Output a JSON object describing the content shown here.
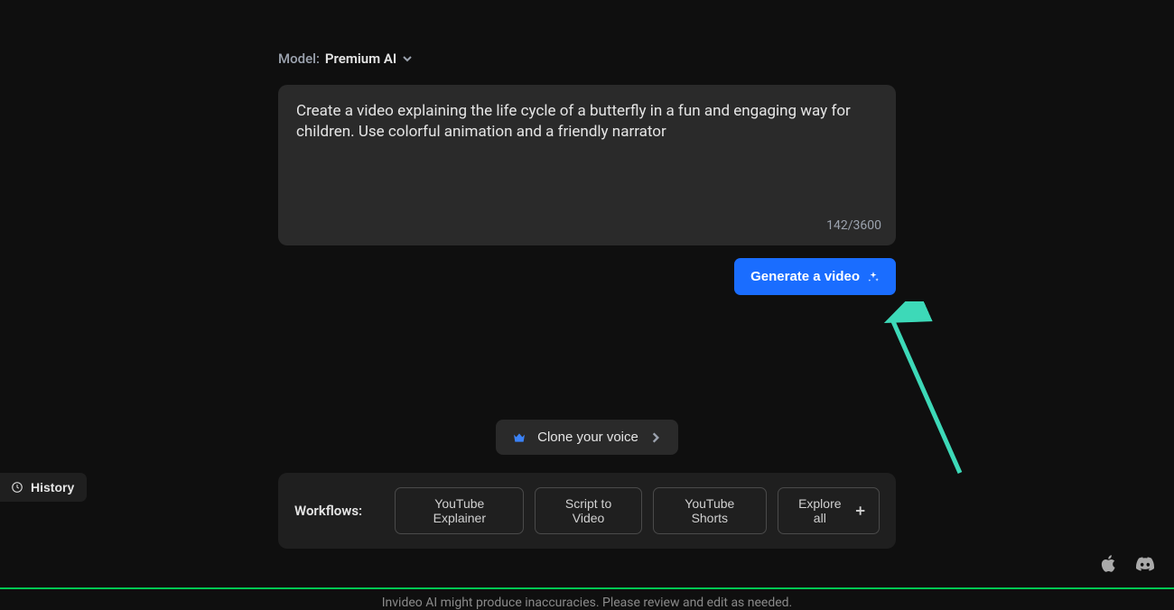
{
  "model": {
    "label": "Model:",
    "name": "Premium AI"
  },
  "prompt": {
    "text": "Create a video explaining the life cycle of a butterfly in a fun and engaging way for children. Use colorful animation and a friendly narrator",
    "counter": "142/3600"
  },
  "generate_button": "Generate a video",
  "clone_voice_button": "Clone your voice",
  "workflows": {
    "label": "Workflows:",
    "chips": [
      "YouTube Explainer",
      "Script to Video",
      "YouTube Shorts"
    ],
    "explore": "Explore all"
  },
  "disclaimer": "Invideo AI might produce inaccuracies. Please review and edit as needed.",
  "history_button": "History"
}
